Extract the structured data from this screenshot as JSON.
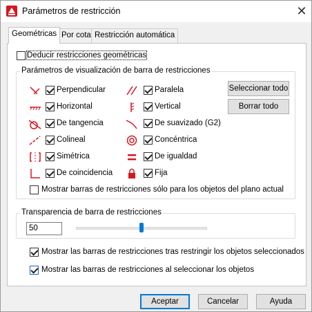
{
  "window": {
    "title": "Parámetros de restricción",
    "close_glyph": "✕"
  },
  "tabs": [
    {
      "label": "Geométricas",
      "active": true
    },
    {
      "label": "Por cota",
      "active": false
    },
    {
      "label": "Restricción automática",
      "active": false
    }
  ],
  "infer": {
    "label": "Deducir restricciones geométricas",
    "checked": false
  },
  "display_group": {
    "title": "Parámetros de visualización de barra de restricciones",
    "left": [
      {
        "label": "Perpendicular",
        "icon": "perpendicular-icon",
        "checked": true
      },
      {
        "label": "Horizontal",
        "icon": "horizontal-icon",
        "checked": true
      },
      {
        "label": "De tangencia",
        "icon": "tangent-icon",
        "checked": true
      },
      {
        "label": "Colineal",
        "icon": "collinear-icon",
        "checked": true
      },
      {
        "label": "Simétrica",
        "icon": "symmetric-icon",
        "checked": true
      },
      {
        "label": "De coincidencia",
        "icon": "coincident-icon",
        "checked": true
      }
    ],
    "right": [
      {
        "label": "Paralela",
        "icon": "parallel-icon",
        "checked": true
      },
      {
        "label": "Vertical",
        "icon": "vertical-icon",
        "checked": true
      },
      {
        "label": "De suavizado (G2)",
        "icon": "smooth-icon",
        "checked": true
      },
      {
        "label": "Concéntrica",
        "icon": "concentric-icon",
        "checked": true
      },
      {
        "label": "De igualdad",
        "icon": "equal-icon",
        "checked": true
      },
      {
        "label": "Fija",
        "icon": "fix-lock-icon",
        "checked": true
      }
    ],
    "select_all": "Seleccionar todo",
    "clear_all": "Borrar todo",
    "current_plane": {
      "label": "Mostrar barras de restricciones sólo para los objetos del plano actual",
      "checked": false
    }
  },
  "transparency": {
    "title": "Transparencia de barra de restricciones",
    "value": "50",
    "slider_percent": 50
  },
  "show_after_apply": {
    "label": "Mostrar las barras de restricciones tras restringir los objetos seleccionados",
    "checked": true
  },
  "show_on_select": {
    "label": "Mostrar las barras de restricciones al seleccionar los objetos",
    "checked": true
  },
  "buttons": {
    "ok": "Aceptar",
    "cancel": "Cancelar",
    "help": "Ayuda"
  },
  "colors": {
    "icon_red": "#d7161f",
    "accent": "#0078d7"
  }
}
